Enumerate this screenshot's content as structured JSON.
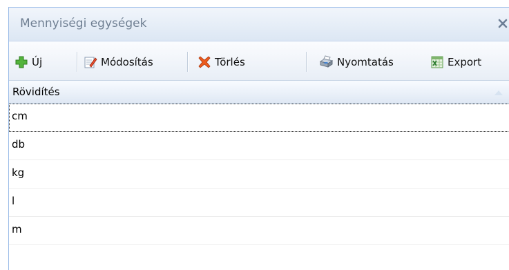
{
  "window": {
    "title": "Mennyiségi egységek"
  },
  "toolbar": {
    "new_label": "Új",
    "edit_label": "Módosítás",
    "delete_label": "Törlés",
    "print_label": "Nyomtatás",
    "export_label": "Export"
  },
  "grid": {
    "column_header": "Rövidítés",
    "sort_direction": "ascending",
    "rows": [
      "cm",
      "db",
      "kg",
      "l",
      "m"
    ]
  },
  "colors": {
    "accent": "#99bbe8",
    "header_text": "#6f7f92"
  }
}
